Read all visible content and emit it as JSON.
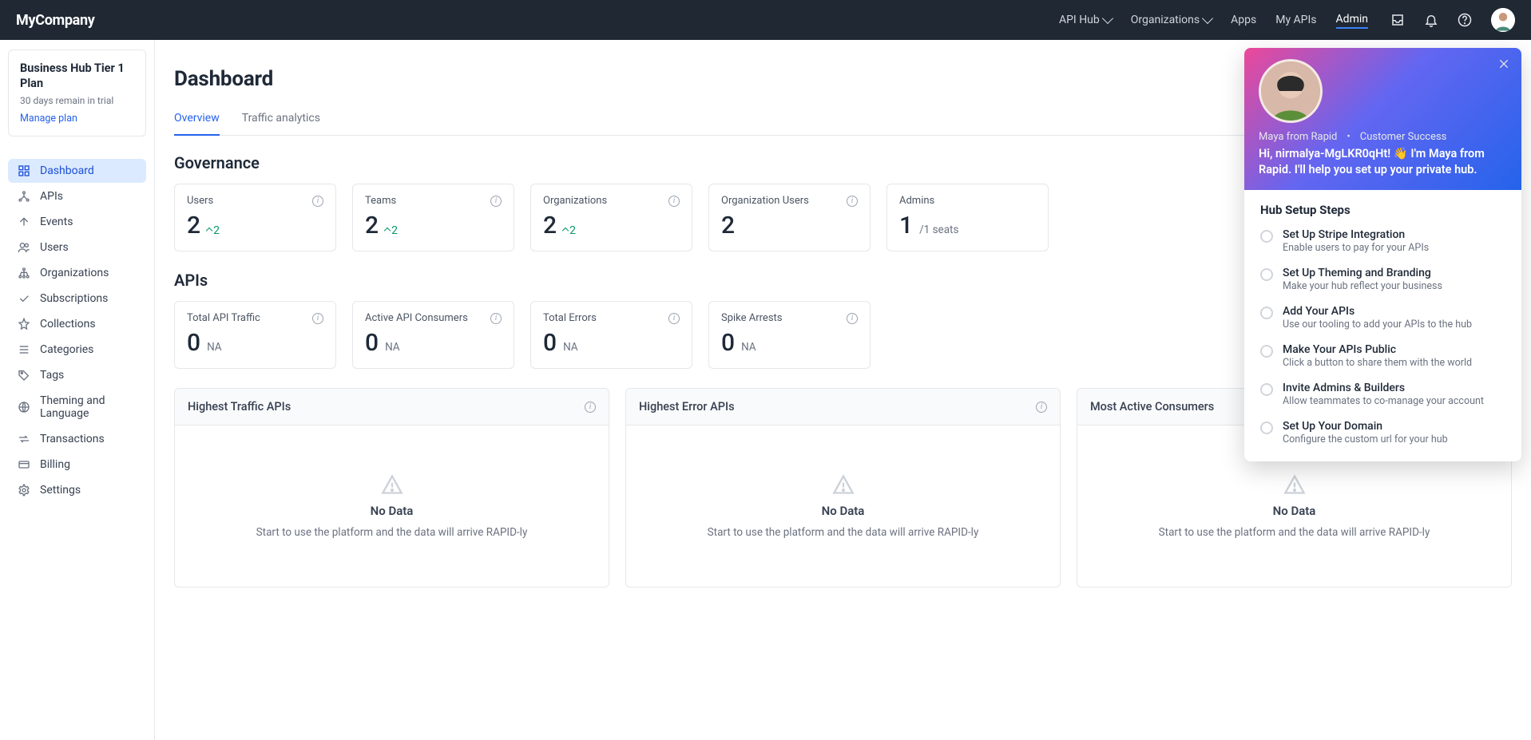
{
  "brand": "MyCompany",
  "header": {
    "nav": [
      "API Hub",
      "Organizations",
      "Apps",
      "My APIs",
      "Admin"
    ]
  },
  "sidebar": {
    "plan": {
      "title": "Business Hub Tier 1 Plan",
      "subtitle": "30 days remain in trial",
      "cta": "Manage plan"
    },
    "items": [
      "Dashboard",
      "APIs",
      "Events",
      "Users",
      "Organizations",
      "Subscriptions",
      "Collections",
      "Categories",
      "Tags",
      "Theming and Language",
      "Transactions",
      "Billing",
      "Settings"
    ]
  },
  "main": {
    "title": "Dashboard",
    "tabs": [
      "Overview",
      "Traffic analytics"
    ],
    "sections": {
      "governance": {
        "title": "Governance",
        "cards": [
          {
            "label": "Users",
            "value": "2",
            "delta": "2"
          },
          {
            "label": "Teams",
            "value": "2",
            "delta": "2"
          },
          {
            "label": "Organizations",
            "value": "2",
            "delta": "2"
          },
          {
            "label": "Organization Users",
            "value": "2"
          },
          {
            "label": "Admins",
            "value": "1",
            "sub": "/1 seats"
          }
        ]
      },
      "apis": {
        "title": "APIs",
        "cards": [
          {
            "label": "Total API Traffic",
            "value": "0",
            "sub": "NA"
          },
          {
            "label": "Active API Consumers",
            "value": "0",
            "sub": "NA"
          },
          {
            "label": "Total Errors",
            "value": "0",
            "sub": "NA"
          },
          {
            "label": "Spike Arrests",
            "value": "0",
            "sub": "NA"
          }
        ]
      }
    },
    "panels": [
      {
        "title": "Highest Traffic APIs",
        "msg": "No Data",
        "sub": "Start to use the platform and the data will arrive RAPID-ly"
      },
      {
        "title": "Highest Error APIs",
        "msg": "No Data",
        "sub": "Start to use the platform and the data will arrive RAPID-ly"
      },
      {
        "title": "Most Active Consumers",
        "msg": "No Data",
        "sub": "Start to use the platform and the data will arrive RAPID-ly"
      }
    ]
  },
  "help": {
    "from": "Maya from Rapid",
    "role": "Customer Success",
    "greeting": "Hi, nirmalya-MgLKR0qHt! 👋 I'm Maya from Rapid. I'll help you set up your private hub.",
    "setupTitle": "Hub Setup Steps",
    "steps": [
      {
        "t": "Set Up Stripe Integration",
        "s": "Enable users to pay for your APIs"
      },
      {
        "t": "Set Up Theming and Branding",
        "s": "Make your hub reflect your business"
      },
      {
        "t": "Add Your APIs",
        "s": "Use our tooling to add your APIs to the hub"
      },
      {
        "t": "Make Your APIs Public",
        "s": "Click a button to share them with the world"
      },
      {
        "t": "Invite Admins & Builders",
        "s": "Allow teammates to co-manage your account"
      },
      {
        "t": "Set Up Your Domain",
        "s": "Configure the custom url for your hub"
      }
    ]
  }
}
